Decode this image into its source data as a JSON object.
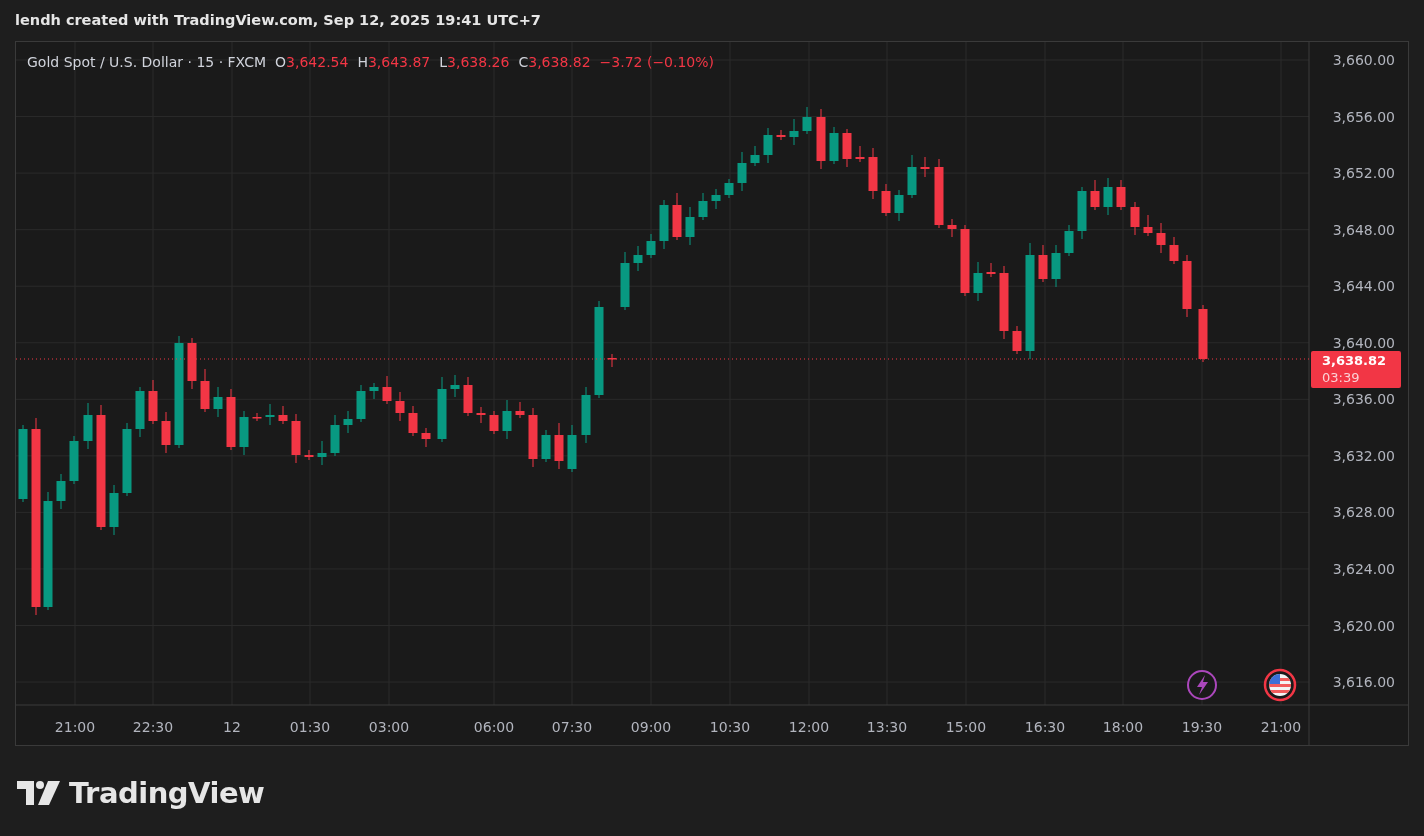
{
  "header": {
    "text": "lendh created with TradingView.com, Sep 12, 2025 19:41 UTC+7"
  },
  "legend": {
    "symbol": "Gold Spot / U.S. Dollar · 15 · FXCM",
    "values": [
      {
        "label": "O",
        "value": "3,642.54"
      },
      {
        "label": "H",
        "value": "3,643.87"
      },
      {
        "label": "L",
        "value": "3,638.26"
      },
      {
        "label": "C",
        "value": "3,638.82"
      }
    ],
    "change": "−3.72 (−0.10%)"
  },
  "price_axis": [
    "3,660.00",
    "3,656.00",
    "3,652.00",
    "3,648.00",
    "3,644.00",
    "3,640.00",
    "3,636.00",
    "3,632.00",
    "3,628.00",
    "3,624.00",
    "3,620.00",
    "3,616.00"
  ],
  "time_axis": [
    "21:00",
    "22:30",
    "12",
    "01:30",
    "03:00",
    "06:00",
    "07:30",
    "09:00",
    "10:30",
    "12:00",
    "13:30",
    "15:00",
    "16:30",
    "18:00",
    "19:30",
    "21:00"
  ],
  "last_price": {
    "price": "3,638.82",
    "countdown": "03:39"
  },
  "logo": {
    "text": "TradingView"
  }
}
